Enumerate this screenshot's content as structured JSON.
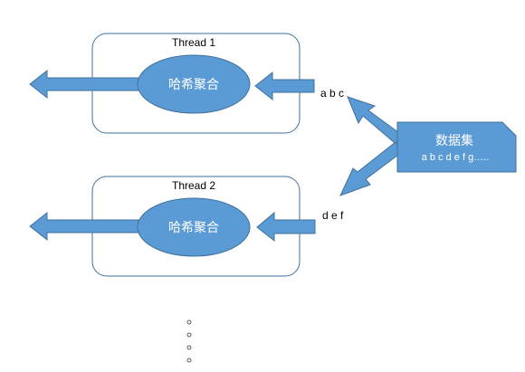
{
  "threads": [
    {
      "title": "Thread 1",
      "node_label": "哈希聚合",
      "input_label": "a b c"
    },
    {
      "title": "Thread 2",
      "node_label": "哈希聚合",
      "input_label": "d e f"
    }
  ],
  "dataset": {
    "title": "数据集",
    "content": "a b c d e f g….."
  },
  "colors": {
    "shape_fill": "#5B9BD5",
    "shape_stroke": "#41719C",
    "box_stroke": "#41719C",
    "text_dark": "#000000",
    "text_light": "#FFFFFF"
  }
}
